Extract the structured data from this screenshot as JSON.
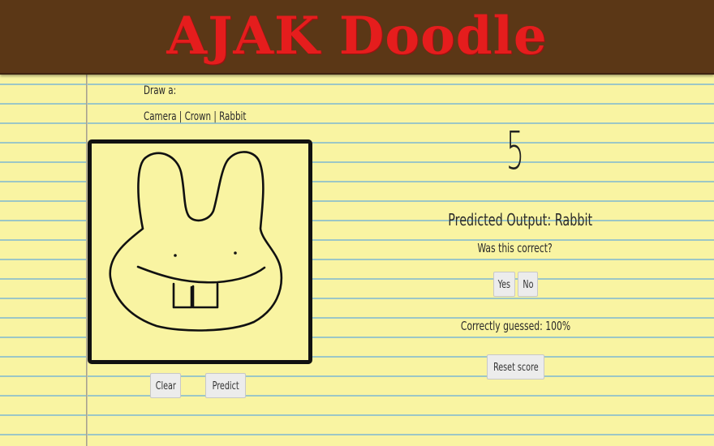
{
  "header": {
    "title": "AJAK Doodle",
    "title_color": "#e51d1d",
    "background_color": "#5b3716"
  },
  "paper": {
    "background_color": "#f9f4a2",
    "rule_color": "#9cc7c6"
  },
  "prompt": {
    "label": "Draw a:",
    "options": "Camera | Crown | Rabbit"
  },
  "canvas": {
    "drawing": "rabbit-doodle"
  },
  "controls": {
    "clear_label": "Clear",
    "predict_label": "Predict"
  },
  "results": {
    "count": "5",
    "predicted_label": "Predicted Output: Rabbit",
    "question": "Was this correct?",
    "yes_label": "Yes",
    "no_label": "No",
    "score_label": "Correctly guessed: 100%",
    "reset_label": "Reset score"
  }
}
